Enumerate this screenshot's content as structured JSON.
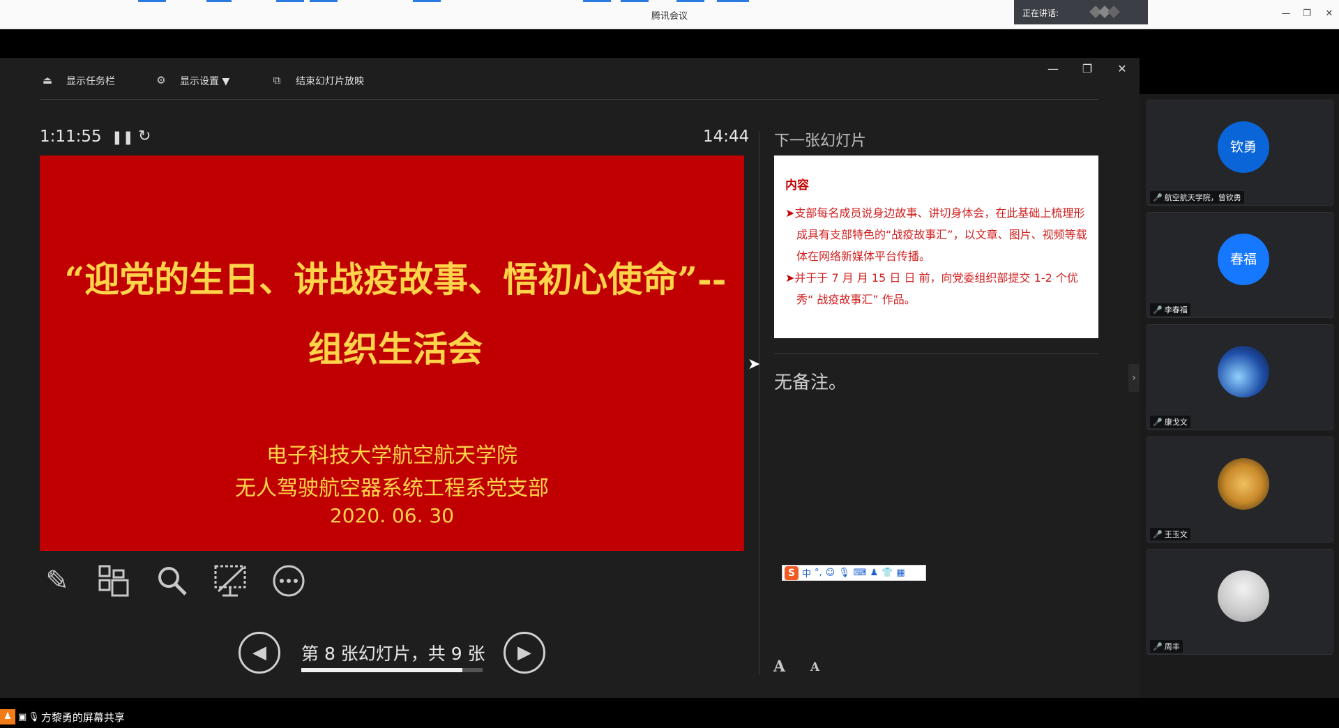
{
  "app": {
    "title": "腾讯会议",
    "speaking_label": "正在讲话:",
    "minimize": "—",
    "restore": "❐",
    "close": "✕"
  },
  "presenter": {
    "toolbar": {
      "taskbar_label": "显示任务栏",
      "display_settings_label": "显示设置 ▼",
      "end_show_label": "结束幻灯片放映"
    },
    "window": {
      "minimize": "—",
      "restore": "❐",
      "close": "✕"
    },
    "timer": "1:11:55",
    "clock": "14:44",
    "slide": {
      "title": "“迎党的生日、讲战疫故事、悟初心使命”--组织生活会",
      "org_line1": "电子科技大学航空航天学院",
      "org_line2": "无人驾驶航空器系统工程系党支部",
      "date": "2020. 06. 30"
    },
    "slide_counter": "第 8 张幻灯片，共 9 张",
    "slide_progress": 0.89,
    "next_slide_label": "下一张幻灯片",
    "next_slide": {
      "title": "内容",
      "items": [
        "支部每名成员说身边故事、讲切身体会，在此基础上梳理形成具有支部特色的“战疫故事汇”，以文章、图片、视频等载体在网络新媒体平台传播。",
        "并于于 7 月 月 15 日 日 前，向党委组织部提交 1-2 个优秀“ 战疫故事汇” 作品。"
      ]
    },
    "notes": "无备注。",
    "ime": {
      "logo": "S",
      "mode": "中",
      "punct": "°,"
    },
    "font_increase": "A",
    "font_decrease": "A"
  },
  "participants": [
    {
      "name": "航空航天学院，曾钦勇",
      "avatar_text": "钦勇",
      "avatar_color": "#0a66d8"
    },
    {
      "name": "李春福",
      "avatar_text": "春福",
      "avatar_color": "#1677ff"
    },
    {
      "name": "康戈文",
      "avatar_text": "",
      "avatar_color": "#1f4fa8"
    },
    {
      "name": "王玉文",
      "avatar_text": "",
      "avatar_color": "#c98a2a"
    },
    {
      "name": "周丰",
      "avatar_text": "",
      "avatar_color": "#c8c8c8"
    }
  ],
  "status": {
    "share_label": "方黎勇的屏幕共享"
  }
}
